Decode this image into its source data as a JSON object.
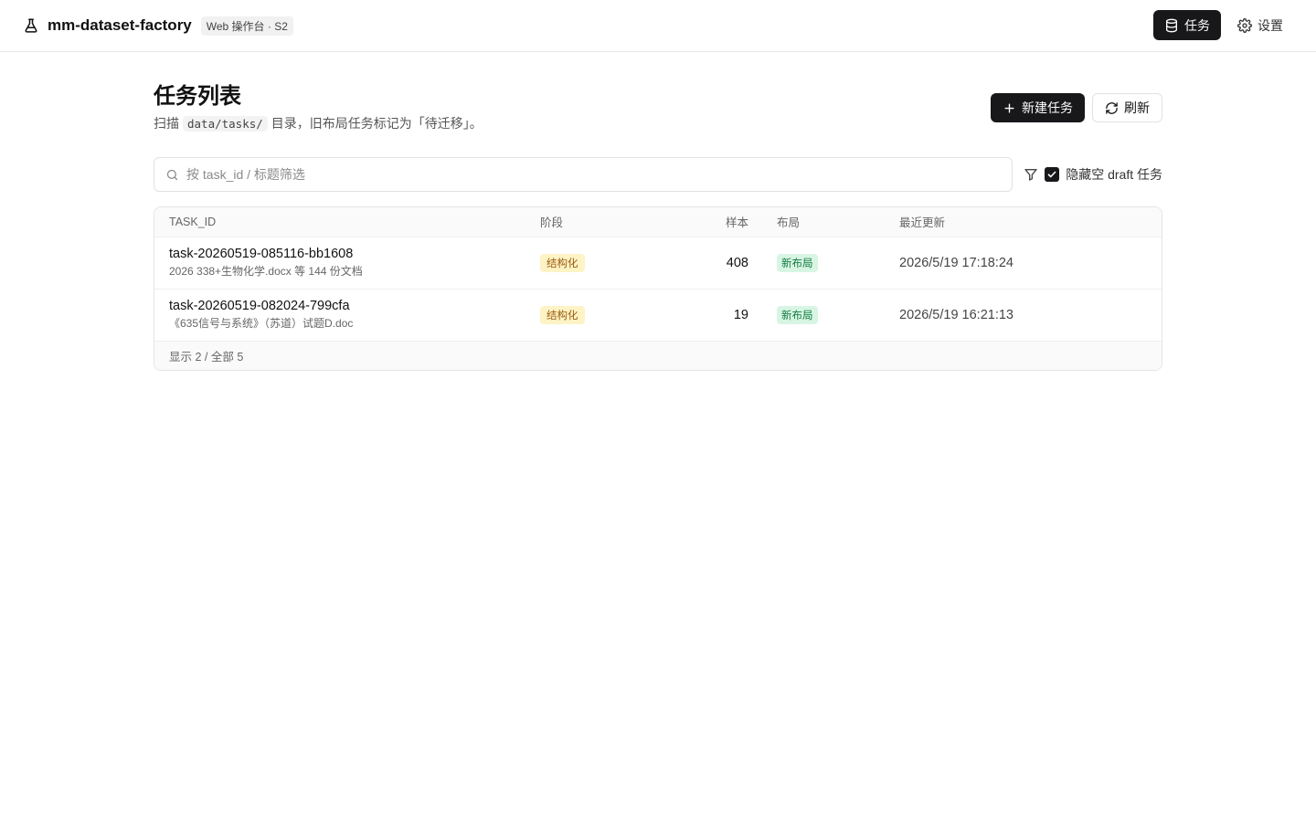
{
  "header": {
    "app_name": "mm-dataset-factory",
    "badge": "Web 操作台 · S2",
    "nav": [
      {
        "label": "任务",
        "icon": "database-icon",
        "active": true
      },
      {
        "label": "设置",
        "icon": "gear-icon",
        "active": false
      }
    ]
  },
  "page": {
    "title": "任务列表",
    "subtitle_prefix": "扫描",
    "subtitle_code": "data/tasks/",
    "subtitle_suffix": "目录，旧布局任务标记为「待迁移」。",
    "new_task_label": "新建任务",
    "refresh_label": "刷新"
  },
  "filter": {
    "search_placeholder": "按 task_id / 标题筛选",
    "search_value": "",
    "hide_empty_label": "隐藏空 draft 任务",
    "hide_empty_checked": true
  },
  "table": {
    "columns": [
      "TASK_ID",
      "阶段",
      "样本",
      "布局",
      "最近更新"
    ],
    "rows": [
      {
        "task_id": "task-20260519-085116-bb1608",
        "title": "2026 338+生物化学.docx 等 144 份文档",
        "stage": "结构化",
        "samples": "408",
        "layout": "新布局",
        "updated": "2026/5/19 17:18:24"
      },
      {
        "task_id": "task-20260519-082024-799cfa",
        "title": "《635信号与系统》（苏道）试题D.doc",
        "stage": "结构化",
        "samples": "19",
        "layout": "新布局",
        "updated": "2026/5/19 16:21:13"
      }
    ],
    "footer": "显示 2 / 全部 5"
  },
  "colors": {
    "primary": "#18181b",
    "stage_badge_bg": "#fdf3c5",
    "stage_badge_text": "#9a5b0c",
    "layout_badge_bg": "#d8f5e4",
    "layout_badge_text": "#117a3f"
  }
}
